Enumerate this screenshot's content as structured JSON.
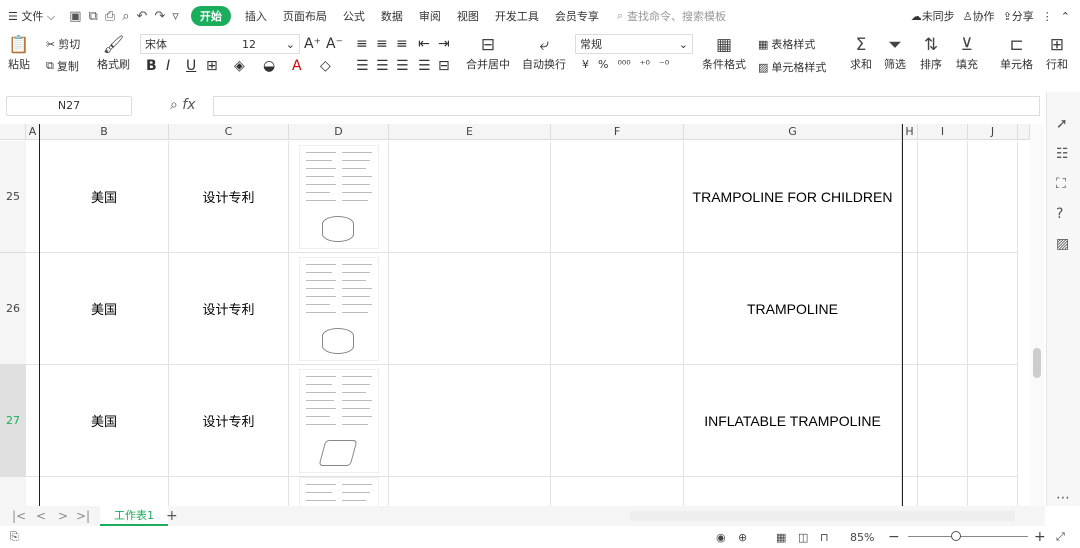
{
  "menu": {
    "file": "文件",
    "tabs": [
      "开始",
      "插入",
      "页面布局",
      "公式",
      "数据",
      "审阅",
      "视图",
      "开发工具",
      "会员专享"
    ],
    "search_placeholder": "查找命令、搜索模板",
    "sync": "未同步",
    "collab": "协作",
    "share": "分享"
  },
  "ribbon": {
    "paste": "粘贴",
    "cut": "剪切",
    "copy": "复制",
    "format_painter": "格式刷",
    "font_name": "宋体",
    "font_size": "12",
    "merge_center": "合并居中",
    "wrap_text": "自动换行",
    "number_format": "常规",
    "conditional_format": "条件格式",
    "table_style": "表格样式",
    "cell_style": "单元格样式",
    "sum": "求和",
    "filter": "筛选",
    "sort": "排序",
    "fill": "填充",
    "cell": "单元格",
    "row_col": "行和"
  },
  "formula_bar": {
    "name_box": "N27",
    "fx_label": "fx",
    "value": ""
  },
  "columns": [
    "A",
    "B",
    "C",
    "D",
    "E",
    "F",
    "G",
    "H",
    "I",
    "J"
  ],
  "rows": [
    {
      "num": "25",
      "country": "美国",
      "type": "设计专利",
      "title": "TRAMPOLINE FOR CHILDREN",
      "selected": false
    },
    {
      "num": "26",
      "country": "美国",
      "type": "设计专利",
      "title": "TRAMPOLINE",
      "selected": false
    },
    {
      "num": "27",
      "country": "美国",
      "type": "设计专利",
      "title": "INFLATABLE TRAMPOLINE",
      "selected": true
    }
  ],
  "sheet": {
    "tab_name": "工作表1",
    "add": "+"
  },
  "status": {
    "zoom": "85%"
  }
}
